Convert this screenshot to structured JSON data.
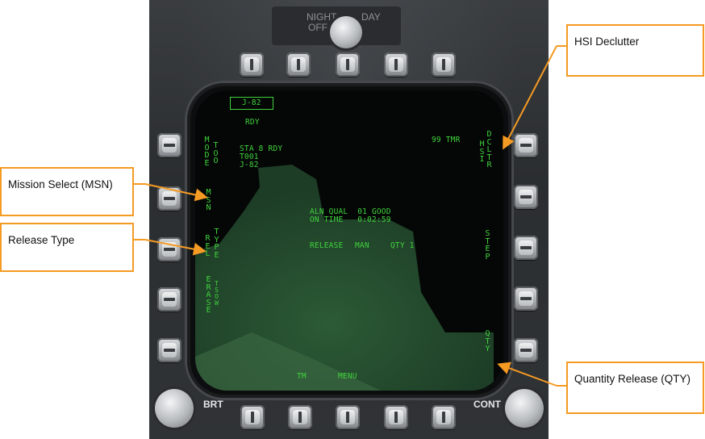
{
  "annotations": {
    "hsi_declutter": "HSI Declutter",
    "mission_select": "Mission Select (MSN)",
    "release_type": "Release Type",
    "quantity_release": "Quantity Release (QTY)"
  },
  "bezel": {
    "night_label": "NIGHT",
    "day_label": "DAY",
    "off_label": "OFF",
    "brt_label": "BRT",
    "cont_label": "CONT"
  },
  "mfd": {
    "weapon_box": "J-82",
    "ready": "RDY",
    "station_lines": [
      "STA 8 RDY",
      "T001",
      "J-82"
    ],
    "timer": "99 TMR",
    "align_quality": "ALN QUAL  01 GOOD",
    "on_time": "ON TIME   0:02:59",
    "release_label": "RELEASE",
    "release_mode": "MAN",
    "quantity": "QTY 1",
    "left_osb": {
      "mode": "MODE",
      "too": "TOO",
      "msn": "MSN",
      "rel": "REL",
      "type": "TYPE",
      "erase": "ERASE",
      "tsow": "TSOW"
    },
    "right_osb": {
      "hsi": "HSI",
      "dcltr": "DCLTR",
      "step": "STEP",
      "qty": "QTY"
    },
    "bottom_osb": {
      "tm": "TM",
      "menu": "MENU"
    }
  },
  "colors": {
    "mfd_green": "#3fd23c",
    "callout_orange": "#f59a23",
    "bezel_gray": "#303336"
  }
}
